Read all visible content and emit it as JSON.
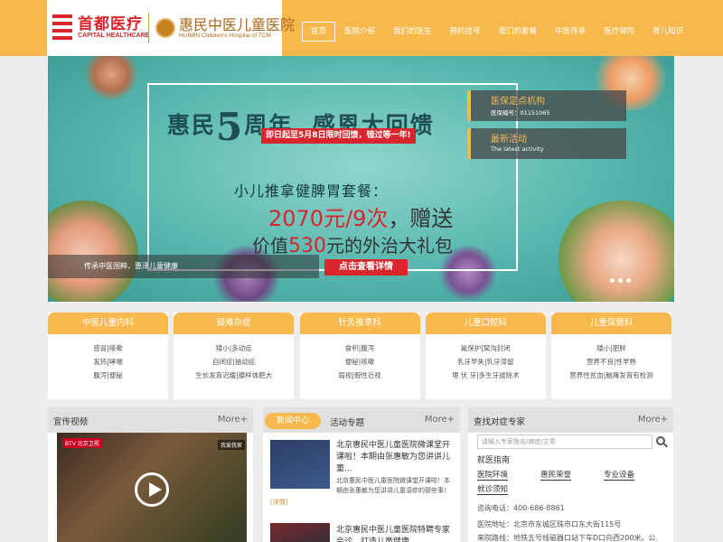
{
  "header": {
    "logo_capital": {
      "name": "首都医疗",
      "en": "CAPITAL HEALTHCARE"
    },
    "logo_huimin": {
      "name": "惠民中医儿童医院",
      "en": "HUIMIN Children's Hospital of TCM"
    },
    "nav": [
      "首页",
      "医院介绍",
      "我们的医生",
      "预约挂号",
      "我们的套餐",
      "中医传承",
      "医疗保险",
      "育儿知识"
    ],
    "active_index": 0
  },
  "banner": {
    "promo_title_a": "惠民",
    "promo_title_5": "5",
    "promo_title_b": "周年",
    "promo_title_c": "感恩大回馈",
    "promo_date": "即日起至5月8日限时回馈，错过等一年!",
    "package_name": "小儿推拿健脾胃套餐：",
    "price_red": "2070元/9次",
    "price_rest": "，赠送",
    "gift_a": "价值",
    "gift_red": "530",
    "gift_b": "元的外治大礼包",
    "detail_button": "点击查看详情",
    "caption": "传承中医国粹，惠泽儿童健康",
    "side_insurance": {
      "title": "医保定点机构",
      "sub": "医保编号：01151065"
    },
    "side_activity": {
      "title": "最新活动",
      "sub": "The latest activity"
    }
  },
  "departments": [
    {
      "title": "中医儿童内科",
      "rows": [
        "感冒|咳嗽",
        "发热|哮喘",
        "腹泻|便秘"
      ]
    },
    {
      "title": "疑难杂症",
      "rows": [
        "矮小|多动症",
        "自闭症|抽动症",
        "生长发育迟缓|腺样体肥大"
      ]
    },
    {
      "title": "针灸推拿科",
      "rows": [
        "食积|腹泻",
        "便秘|咳嗽",
        "弱视|假性近视"
      ]
    },
    {
      "title": "儿童口腔科",
      "rows": [
        "氟保护|窝沟封闭",
        "乳牙早失|乳牙滞留",
        "埋 伏 牙|多生牙拔除术"
      ]
    },
    {
      "title": "儿童保健科",
      "rows": [
        "矮小|肥胖",
        "营养不良|性早熟",
        "营养性贫血|脑瘫发育有检测"
      ]
    }
  ],
  "video_panel": {
    "title": "宣传视频",
    "more": "More+",
    "badge_left": "BTV 北京卫视",
    "badge_right": "我爱我家"
  },
  "news_panel": {
    "tab_active": "新闻中心",
    "tab_other": "活动专题",
    "more": "More+",
    "items": [
      {
        "title": "北京惠民中医儿童医院微课堂开课啦！本期由张惠敏为您讲讲儿童...",
        "summary": "北京惠民中医儿童医院微课堂开课啦！本期由张惠敏为您讲讲儿童湿疹的那些事！",
        "hint": "[详情]"
      },
      {
        "title": "北京惠民中医儿童医院特聘专家会诊，打造儿童健康"
      }
    ]
  },
  "expert_panel": {
    "title": "查找对症专家",
    "more": "More+",
    "search_placeholder": "请输入专家姓名/病症/文章",
    "guide_title": "就医指南",
    "links": [
      "医院环境",
      "惠民荣誉",
      "专业设备",
      "就诊须知"
    ],
    "phone": "咨询电话：400-686-8861",
    "address": "医院地址：北京市东城区珠市口东大街115号",
    "route": "来院路线：地铁五号线磁器口站下车D口向西200米。公"
  },
  "colors": {
    "accent": "#f7b94e",
    "red": "#d8262c",
    "teal": "#57b7ae"
  }
}
